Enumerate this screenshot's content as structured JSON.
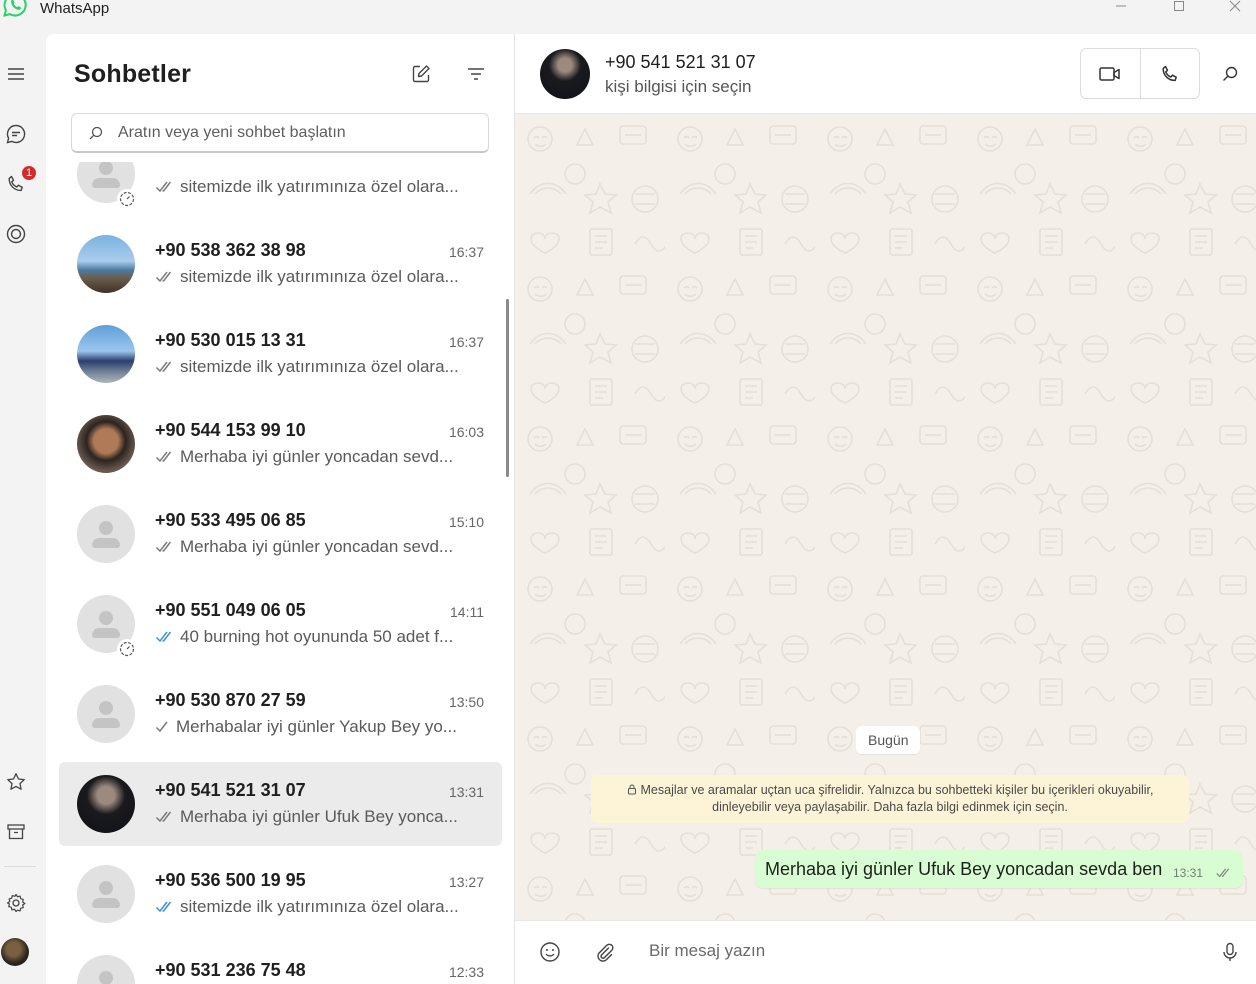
{
  "window": {
    "title": "WhatsApp"
  },
  "sidebar": {
    "title": "Sohbetler",
    "search_placeholder": "Aratın veya yeni sohbet başlatın",
    "calls_badge": "1",
    "chats": [
      {
        "name": "",
        "time": "",
        "preview": "sitemizde ilk yatırımınıza özel olara...",
        "tick": "double-gray",
        "avatar": "default",
        "status": true,
        "active": false
      },
      {
        "name": "+90 538 362 38 98",
        "time": "16:37",
        "preview": "sitemizde ilk yatırımınıza özel olara...",
        "tick": "double-gray",
        "avatar": "photo",
        "status": false,
        "active": false
      },
      {
        "name": "+90 530 015 13 31",
        "time": "16:37",
        "preview": "sitemizde ilk yatırımınıza özel olara...",
        "tick": "double-gray",
        "avatar": "photo",
        "status": false,
        "active": false
      },
      {
        "name": "+90 544 153 99 10",
        "time": "16:03",
        "preview": "Merhaba iyi günler yoncadan sevd...",
        "tick": "double-gray",
        "avatar": "photo",
        "status": false,
        "active": false
      },
      {
        "name": "+90 533 495 06 85",
        "time": "15:10",
        "preview": "Merhaba iyi günler yoncadan sevd...",
        "tick": "double-gray",
        "avatar": "default",
        "status": false,
        "active": false
      },
      {
        "name": "+90 551 049 06 05",
        "time": "14:11",
        "preview": "40 burning hot oyununda 50 adet f...",
        "tick": "double-blue",
        "avatar": "default",
        "status": true,
        "active": false
      },
      {
        "name": "+90 530 870 27 59",
        "time": "13:50",
        "preview": "Merhabalar iyi günler  Yakup Bey yo...",
        "tick": "single-gray",
        "avatar": "default",
        "status": false,
        "active": false
      },
      {
        "name": "+90 541 521 31 07",
        "time": "13:31",
        "preview": "Merhaba iyi günler Ufuk Bey yonca...",
        "tick": "double-gray",
        "avatar": "photo",
        "status": false,
        "active": true
      },
      {
        "name": "+90 536 500 19 95",
        "time": "13:27",
        "preview": "sitemizde ilk yatırımınıza özel olara...",
        "tick": "double-blue",
        "avatar": "default",
        "status": false,
        "active": false
      },
      {
        "name": "+90 531 236 75 48",
        "time": "12:33",
        "preview": "",
        "tick": "",
        "avatar": "default",
        "status": false,
        "active": false
      }
    ]
  },
  "conversation": {
    "name": "+90 541 521 31 07",
    "subtitle": "kişi bilgisi için seçin",
    "date_chip": "Bugün",
    "encryption_notice": "Mesajlar ve aramalar uçtan uca şifrelidir. Yalnızca bu sohbetteki kişiler bu içerikleri okuyabilir, dinleyebilir veya paylaşabilir. Daha fazla bilgi edinmek için seçin.",
    "messages": [
      {
        "text": "Merhaba iyi günler Ufuk Bey yoncadan sevda ben",
        "time": "13:31",
        "outgoing": true,
        "status": "double-gray"
      }
    ],
    "composer_placeholder": "Bir mesaj yazın"
  },
  "colors": {
    "outgoing_bubble": "#d9fdd3",
    "read_tick": "#53bdeb",
    "badge": "#d42a2a",
    "brand": "#25d366"
  },
  "icons": {
    "rail": [
      "menu-icon",
      "chats-icon",
      "calls-icon",
      "status-icon",
      "starred-icon",
      "archive-icon",
      "settings-icon"
    ],
    "header": [
      "video-call-icon",
      "voice-call-icon",
      "search-icon"
    ],
    "composer": [
      "emoji-icon",
      "attach-icon",
      "mic-icon"
    ]
  }
}
